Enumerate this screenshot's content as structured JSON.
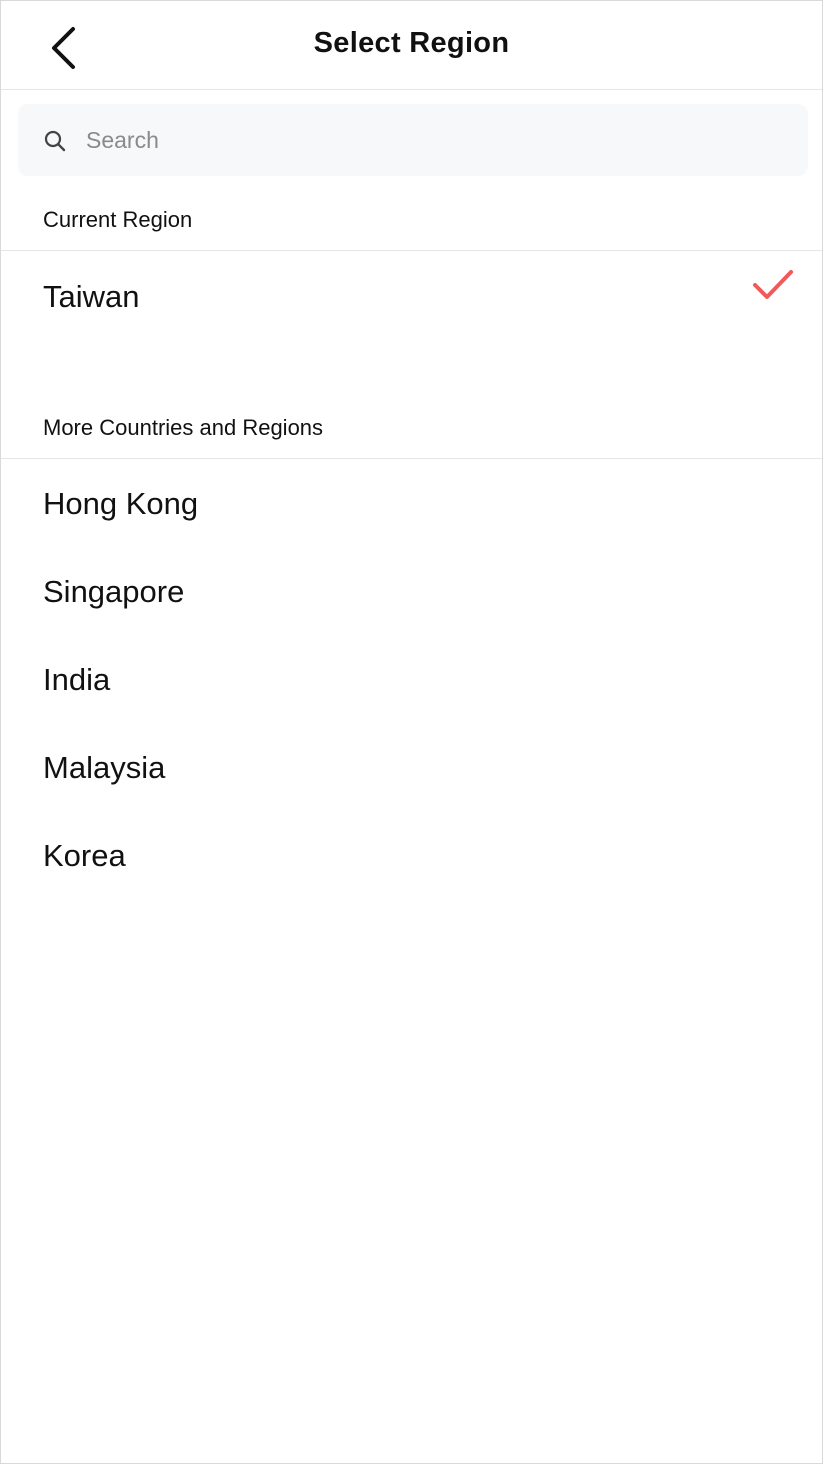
{
  "header": {
    "title": "Select Region",
    "back_icon": "chevron-left-icon"
  },
  "search": {
    "placeholder": "Search",
    "value": "",
    "icon": "search-icon"
  },
  "current_section": {
    "label": "Current Region",
    "item": {
      "label": "Taiwan",
      "selected": true,
      "check_icon": "check-icon"
    }
  },
  "more_section": {
    "label": "More Countries and Regions",
    "items": [
      {
        "label": "Hong Kong"
      },
      {
        "label": "Singapore"
      },
      {
        "label": "India"
      },
      {
        "label": "Malaysia"
      },
      {
        "label": "Korea"
      }
    ]
  },
  "colors": {
    "accent": "#f25a5a",
    "search_bg": "#f7f8fa",
    "divider": "#e6e6e6"
  }
}
